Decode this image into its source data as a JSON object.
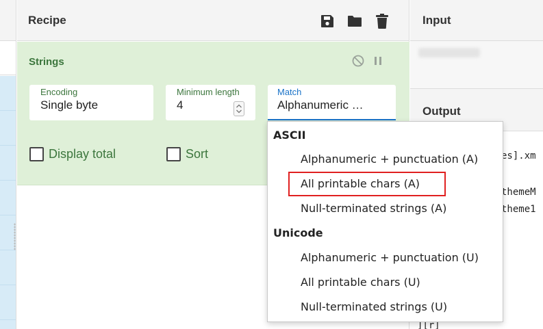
{
  "recipe": {
    "title": "Recipe",
    "toolbar_icons": [
      "save-icon",
      "folder-icon",
      "trash-icon"
    ]
  },
  "operation": {
    "name": "Strings",
    "encoding_label": "Encoding",
    "encoding_value": "Single byte",
    "min_length_label": "Minimum length",
    "min_length_value": "4",
    "match_label": "Match",
    "match_value": "Alphanumeric …",
    "display_total_label": "Display total",
    "sort_label": "Sort"
  },
  "input": {
    "title": "Input"
  },
  "output": {
    "title": "Output",
    "lines": [
      "es].xm",
      "themeM",
      "theme1",
      "][r]"
    ]
  },
  "dropdown": {
    "groups": [
      {
        "label": "ASCII",
        "options": [
          "Alphanumeric + punctuation (A)",
          "All printable chars (A)",
          "Null-terminated strings (A)"
        ]
      },
      {
        "label": "Unicode",
        "options": [
          "Alphanumeric + punctuation (U)",
          "All printable chars (U)",
          "Null-terminated strings (U)"
        ]
      }
    ],
    "highlighted_option": "All printable chars (A)"
  },
  "colors": {
    "op_background": "#dff0d8",
    "op_text": "#3c763d",
    "accent": "#1a73c8",
    "highlight": "#e02020",
    "ops_list": "#d7ebf7"
  }
}
